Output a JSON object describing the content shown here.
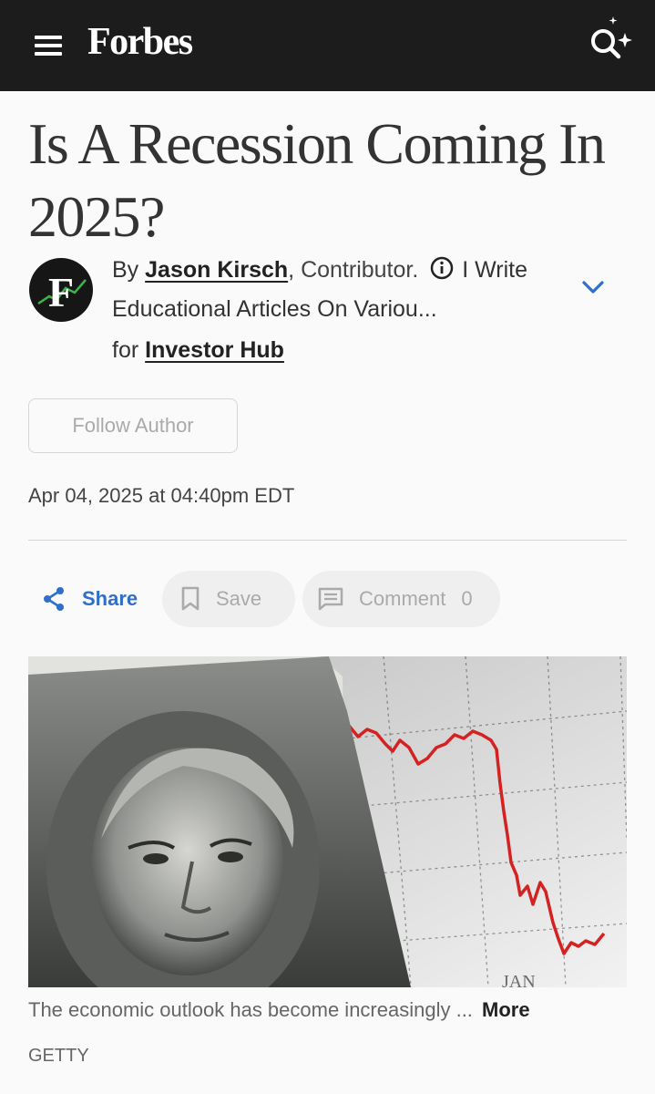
{
  "header": {
    "logo": "Forbes",
    "menu_icon": "hamburger-menu-icon",
    "search_icon": "search-sparkle-icon",
    "background": "#1c1c1c"
  },
  "article": {
    "headline": "Is A Recession Coming In 2025?",
    "byline": {
      "by": "By",
      "author": "Jason Kirsch",
      "comma": ",",
      "role": "Contributor.",
      "bio": "I Write Educational Articles On Variou...",
      "for": "for",
      "publication": "Investor Hub",
      "avatar_letter": "F"
    },
    "follow_label": "Follow Author",
    "date": "Apr 04, 2025 at 04:40pm EDT",
    "actions": {
      "share_label": "Share",
      "save_label": "Save",
      "comment_label": "Comment",
      "comment_count": "0"
    },
    "image_caption": "The economic outlook has become increasingly ...",
    "more_label": "More",
    "image_credit": "GETTY"
  },
  "colors": {
    "accent": "#2e6fc9",
    "chart_line": "#d42222",
    "avatar_chart": "#3ab54a"
  }
}
